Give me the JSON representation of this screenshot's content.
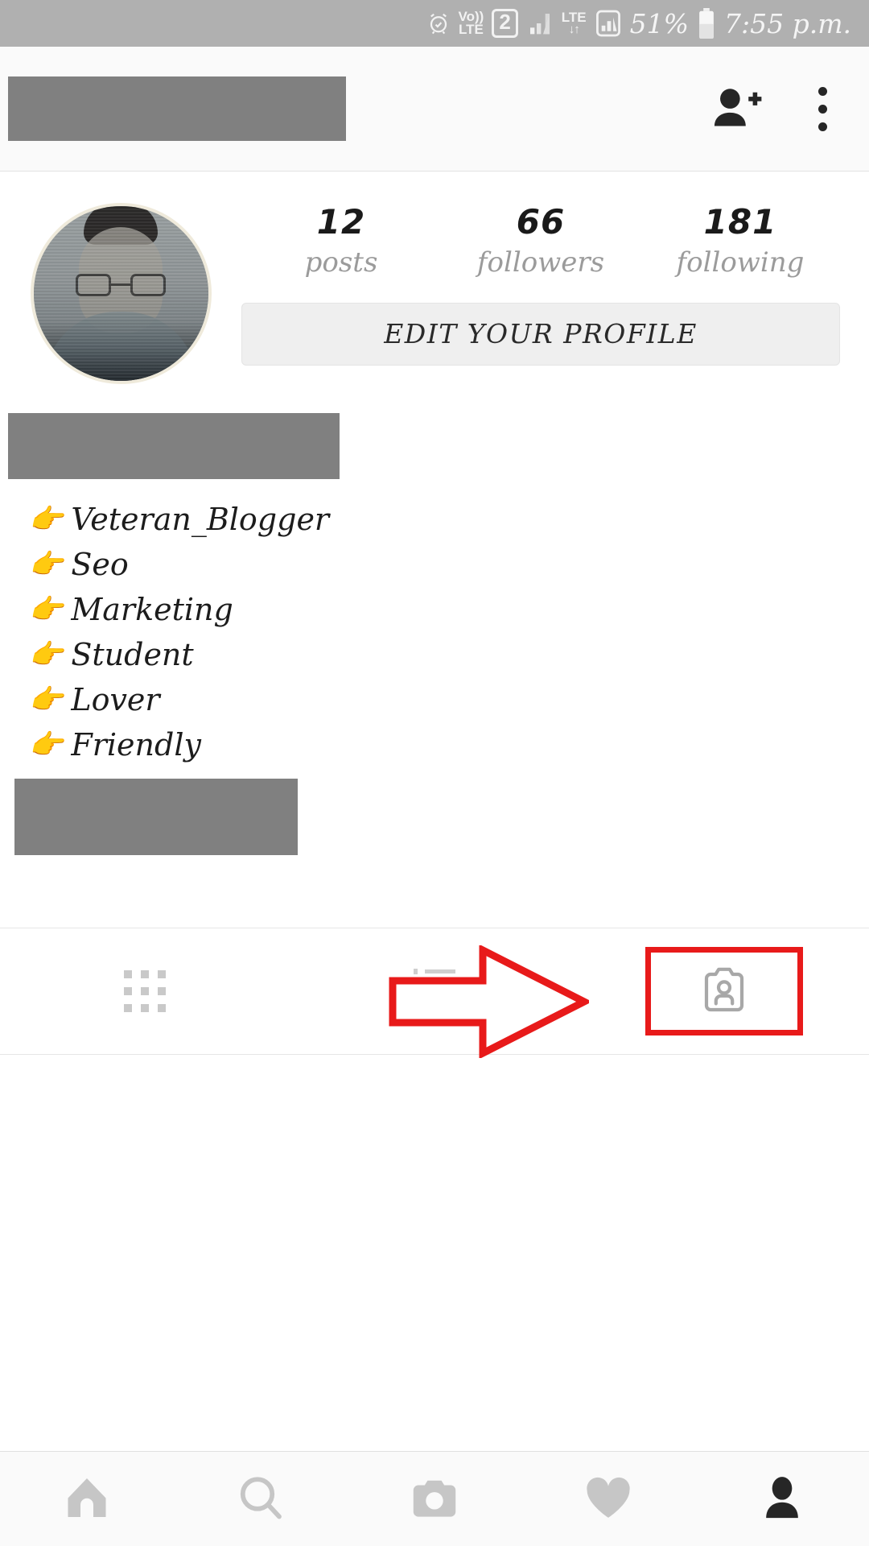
{
  "status_bar": {
    "alarm_icon": "alarm-clock-icon",
    "volte_line1": "Vo))",
    "volte_line2": "LTE",
    "sim_badge": "2",
    "signal_icon": "signal-bars-icon",
    "lte_label": "LTE",
    "lte_data_arrows": "↓↑",
    "signal2_icon": "signal-bars-boxed-icon",
    "battery_percent": "51%",
    "battery_icon": "battery-icon",
    "time": "7:55 p.m."
  },
  "header": {
    "username_redacted": "",
    "add_person_icon": "add-person-icon",
    "overflow_icon": "kebab-menu-icon"
  },
  "profile": {
    "avatar_alt": "profile-photo",
    "stats": [
      {
        "value": "12",
        "label": "posts"
      },
      {
        "value": "66",
        "label": "followers"
      },
      {
        "value": "181",
        "label": "following"
      }
    ],
    "edit_button": "EDIT YOUR PROFILE"
  },
  "bio": {
    "display_name_redacted": "",
    "pointer_emoji": "👉",
    "lines": [
      "Veteran_Blogger",
      "Seo",
      "Marketing",
      "Student",
      "Lover",
      "Friendly"
    ],
    "footer_redacted": ""
  },
  "tabs": [
    {
      "name": "grid-tab",
      "icon": "grid-icon",
      "selected": "false"
    },
    {
      "name": "list-tab",
      "icon": "list-icon",
      "selected": "false"
    },
    {
      "name": "tagged-tab",
      "icon": "tagged-photos-icon",
      "selected": "false"
    }
  ],
  "annotation": {
    "arrow_icon": "red-arrow-pointing-right",
    "highlight_color": "#e81a1a",
    "target": "tagged-tab"
  },
  "bottom_nav": [
    {
      "name": "home",
      "icon": "home-icon",
      "active": "false"
    },
    {
      "name": "search",
      "icon": "search-icon",
      "active": "false"
    },
    {
      "name": "camera",
      "icon": "camera-icon",
      "active": "false"
    },
    {
      "name": "activity",
      "icon": "heart-icon",
      "active": "false"
    },
    {
      "name": "profile",
      "icon": "person-icon",
      "active": "true"
    }
  ],
  "colors": {
    "status_bar_bg": "#b0b0b0",
    "header_bg": "#fafafa",
    "redaction": "#808080",
    "accent_red": "#e81a1a",
    "text_dark": "#1a1a1a",
    "text_muted": "#9b9b9b",
    "icon_gray": "#c9c9c9"
  }
}
